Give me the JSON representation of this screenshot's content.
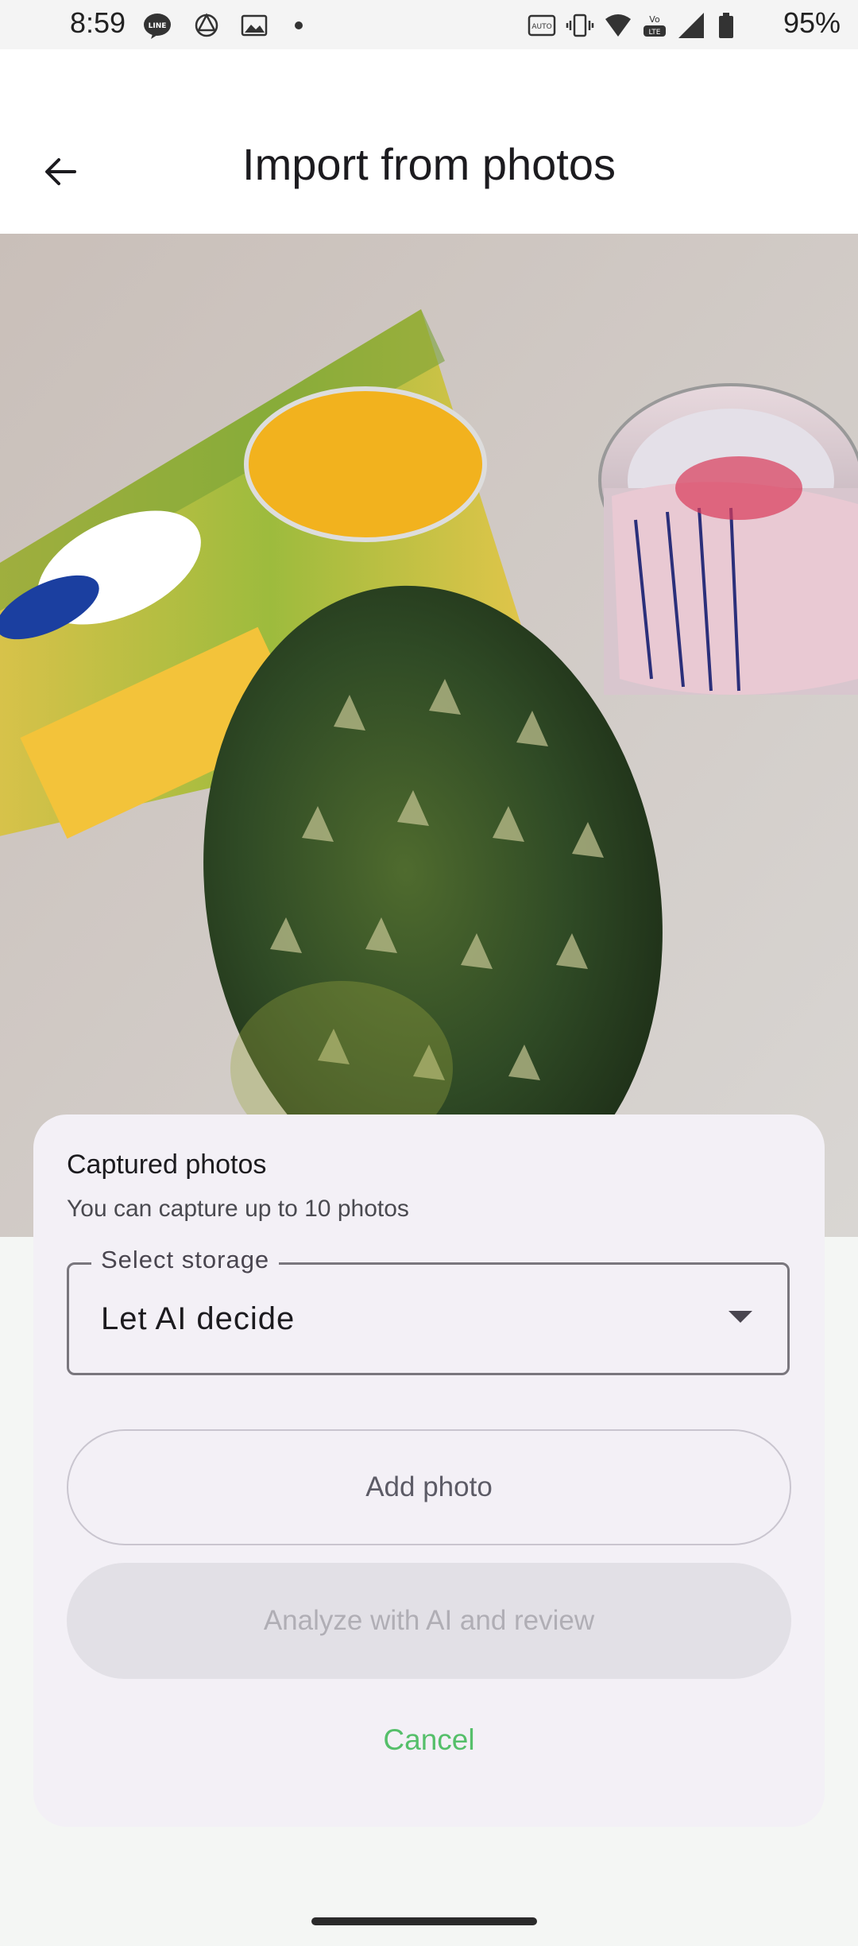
{
  "status_bar": {
    "time": "8:59",
    "battery": "95%",
    "icons": [
      "line-app-icon",
      "openai-icon",
      "gallery-icon",
      "dot-icon",
      "auto-hd-icon",
      "vibrate-icon",
      "wifi-icon",
      "volte-icon",
      "signal-icon",
      "battery-icon"
    ]
  },
  "app_bar": {
    "title": "Import from photos",
    "back_icon": "arrow-back-icon"
  },
  "photo": {
    "description_icon": "captured-photo"
  },
  "sheet": {
    "title": "Captured photos",
    "subtitle": "You can capture up to 10 photos",
    "storage": {
      "label": "Select storage",
      "value": "Let AI decide"
    },
    "add_photo_label": "Add photo",
    "analyze_label": "Analyze with AI and review",
    "cancel_label": "Cancel"
  },
  "colors": {
    "accent": "#55bf6a",
    "sheet_bg": "#f3f0f6",
    "disabled_button": "#e2e0e6"
  }
}
